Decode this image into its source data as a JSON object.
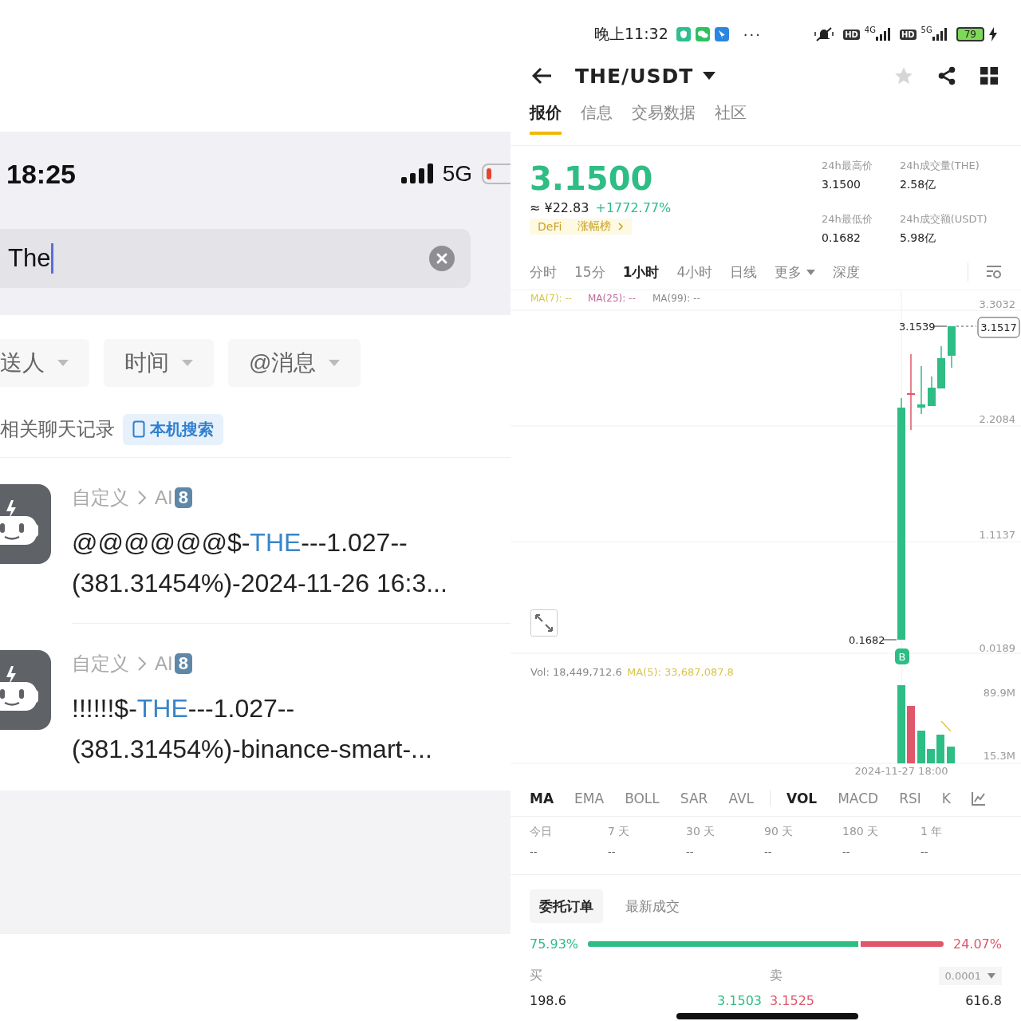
{
  "left_screen": {
    "status_bar": {
      "time": "18:25",
      "network": "5G"
    },
    "search": {
      "value": "The"
    },
    "filters": [
      {
        "label": "送人"
      },
      {
        "label": "时间"
      },
      {
        "label": "@消息"
      }
    ],
    "results_note": "相关聊天记录",
    "local_search_button": "本机搜索",
    "results": [
      {
        "path": "自定义",
        "group": "AI",
        "badge": "8",
        "before": "@@@@@@$-",
        "match": "THE",
        "after": "---1.027--",
        "second_line": "(381.31454%)-2024-11-26 16:3..."
      },
      {
        "path": "自定义",
        "group": "AI",
        "badge": "8",
        "before": "!!!!!!$-",
        "match": "THE",
        "after": "---1.027--",
        "second_line": "(381.31454%)-binance-smart-..."
      }
    ]
  },
  "right_screen": {
    "status_bar": {
      "time": "晚上11:32",
      "more": "···",
      "networks": [
        {
          "badge": "HD",
          "type": "4G"
        },
        {
          "badge": "HD",
          "type": "5G"
        }
      ],
      "battery": "79"
    },
    "header": {
      "pair": "THE/USDT"
    },
    "tabs": [
      {
        "label": "报价",
        "selected": true
      },
      {
        "label": "信息",
        "selected": false
      },
      {
        "label": "交易数据",
        "selected": false
      },
      {
        "label": "社区",
        "selected": false
      }
    ],
    "price": {
      "last": "3.1500",
      "fiat": "≈ ¥22.83",
      "change": "+1772.77%",
      "tags": [
        {
          "label": "DeFi",
          "kind": "plain"
        },
        {
          "label": "涨幅榜",
          "kind": "link"
        }
      ]
    },
    "stats": [
      {
        "label": "24h最高价",
        "value": "3.1500"
      },
      {
        "label": "24h成交量(THE)",
        "value": "2.58亿"
      },
      {
        "label": "24h最低价",
        "value": "0.1682"
      },
      {
        "label": "24h成交额(USDT)",
        "value": "5.98亿"
      }
    ],
    "intervals": [
      {
        "label": "分时",
        "selected": false,
        "kind": "plain"
      },
      {
        "label": "15分",
        "selected": false,
        "kind": "plain"
      },
      {
        "label": "1小时",
        "selected": true,
        "kind": "plain"
      },
      {
        "label": "4小时",
        "selected": false,
        "kind": "plain"
      },
      {
        "label": "日线",
        "selected": false,
        "kind": "plain"
      },
      {
        "label": "更多",
        "selected": false,
        "kind": "dropdown"
      },
      {
        "label": "深度",
        "selected": false,
        "kind": "plain"
      }
    ],
    "chart": {
      "ma_legend": [
        {
          "label": "MA(7): --",
          "color": "#d8c44a"
        },
        {
          "label": "MA(25): --",
          "color": "#c06a9e"
        },
        {
          "label": "MA(99): --",
          "color": "#8a8a8a"
        }
      ],
      "y_labels": [
        "3.3032",
        "2.2084",
        "1.1137",
        "0.0189"
      ],
      "high_label": "3.1539",
      "current_price": "3.1517",
      "low_label": "0.1682",
      "marker": "B",
      "volume_label": "Vol: 18,449,712.6",
      "volume_ma": "MA(5): 33,687,087.8",
      "volume_y_labels": [
        "89.9M",
        "15.3M"
      ],
      "x_label": "2024-11-27 18:00"
    },
    "indicators": [
      {
        "label": "MA",
        "selected": true
      },
      {
        "label": "EMA",
        "selected": false
      },
      {
        "label": "BOLL",
        "selected": false
      },
      {
        "label": "SAR",
        "selected": false
      },
      {
        "label": "AVL",
        "selected": false
      },
      {
        "label": "VOL",
        "selected": true
      },
      {
        "label": "MACD",
        "selected": false
      },
      {
        "label": "RSI",
        "selected": false
      },
      {
        "label": "K",
        "selected": false
      }
    ],
    "periods": [
      {
        "label": "今日",
        "value": "--"
      },
      {
        "label": "7 天",
        "value": "--"
      },
      {
        "label": "30 天",
        "value": "--"
      },
      {
        "label": "90 天",
        "value": "--"
      },
      {
        "label": "180 天",
        "value": "--"
      },
      {
        "label": "1 年",
        "value": "--"
      }
    ],
    "book_tabs": [
      {
        "label": "委托订单",
        "selected": true
      },
      {
        "label": "最新成交",
        "selected": false
      }
    ],
    "ratio": {
      "buy": "75.93%",
      "sell": "24.07%",
      "level": 0.7593
    },
    "book_header": {
      "buy": "买",
      "sell": "卖",
      "precision": "0.0001"
    },
    "book_row": {
      "buy_qty": "198.6",
      "buy_price": "3.1503",
      "sell_price": "3.1525",
      "sell_qty": "616.8"
    }
  }
}
